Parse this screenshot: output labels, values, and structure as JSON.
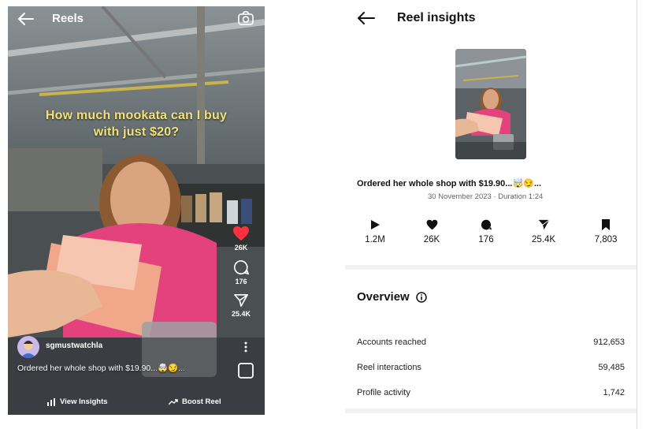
{
  "reel_view": {
    "title": "Reels",
    "overlay_caption_line1": "How much mookata can I buy",
    "overlay_caption_line2": "with just $20?",
    "likes": "26K",
    "comments": "176",
    "shares": "25.4K",
    "author": "sgmustwatchla",
    "caption": "Ordered her whole shop with $19.90...🤯😏...",
    "view_insights_label": "View Insights",
    "boost_label": "Boost Reel",
    "icons": [
      "back-arrow-icon",
      "camera-icon",
      "heart-icon",
      "comment-icon",
      "share-icon",
      "more-icon",
      "audio-thumb-icon",
      "bar-chart-icon",
      "trend-up-icon"
    ]
  },
  "insights": {
    "title": "Reel insights",
    "caption": "Ordered her whole shop with $19.90...🤯😏...",
    "meta": "30 November 2023 · Duration 1:24",
    "stats": [
      {
        "icon": "play-icon",
        "value": "1.2M"
      },
      {
        "icon": "heart-icon",
        "value": "26K"
      },
      {
        "icon": "comment-icon",
        "value": "176"
      },
      {
        "icon": "share-icon",
        "value": "25.4K"
      },
      {
        "icon": "bookmark-icon",
        "value": "7,803"
      }
    ],
    "overview": {
      "title": "Overview",
      "rows": [
        {
          "label": "Accounts reached",
          "value": "912,653"
        },
        {
          "label": "Reel interactions",
          "value": "59,485"
        },
        {
          "label": "Profile activity",
          "value": "1,742"
        }
      ]
    }
  },
  "colors": {
    "overlay_text": "#f1e27a",
    "like_red": "#ff3040",
    "text_dark": "#111111",
    "text_muted": "#666666"
  }
}
